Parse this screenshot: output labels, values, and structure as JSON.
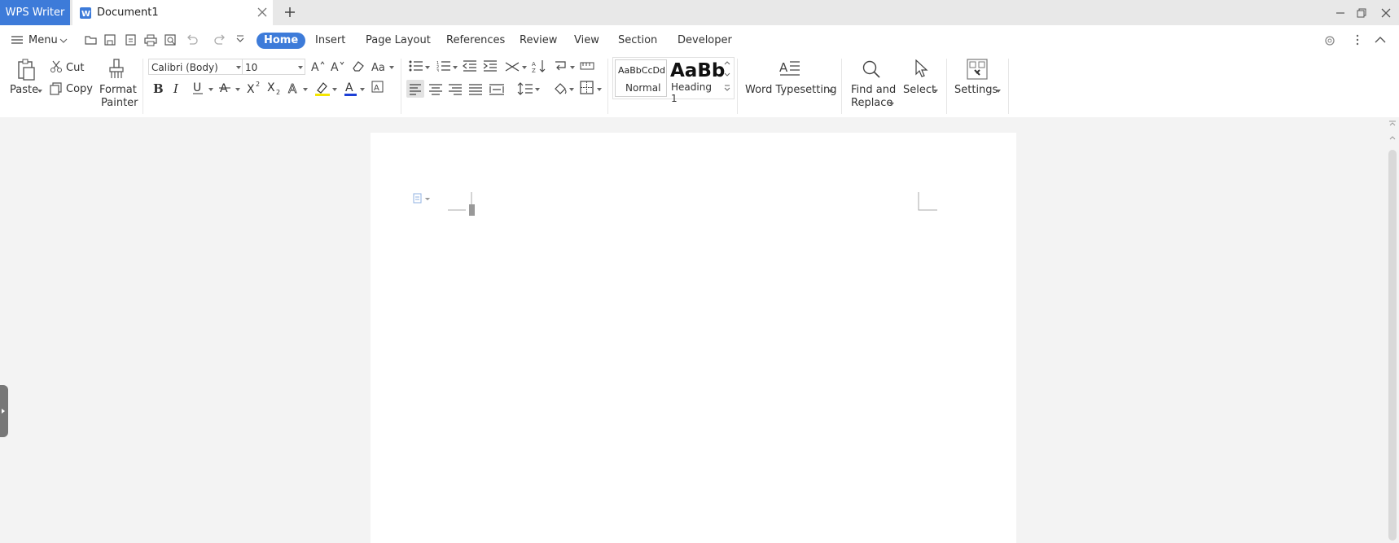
{
  "titlebar": {
    "app_name": "WPS Writer",
    "document_tab": "Document1"
  },
  "menubar": {
    "menu_label": "Menu",
    "tabs": [
      "Home",
      "Insert",
      "Page Layout",
      "References",
      "Review",
      "View",
      "Section",
      "Developer"
    ],
    "active_tab": "Home"
  },
  "ribbon": {
    "clipboard": {
      "paste": "Paste",
      "cut": "Cut",
      "copy": "Copy",
      "format_painter_line1": "Format",
      "format_painter_line2": "Painter"
    },
    "font": {
      "family": "Calibri (Body)",
      "size": "10"
    },
    "styles": {
      "normal_preview": "AaBbCcDd",
      "normal_label": "Normal",
      "heading1_preview": "AaBb",
      "heading1_label": "Heading 1"
    },
    "word_typesetting": "Word Typesetting",
    "find_replace_line1": "Find and",
    "find_replace_line2": "Replace",
    "select": "Select",
    "settings": "Settings"
  },
  "colors": {
    "accent": "#3d7bd9",
    "font_color_bar": "#1c3fd6",
    "highlight_bar": "#f5e600"
  }
}
